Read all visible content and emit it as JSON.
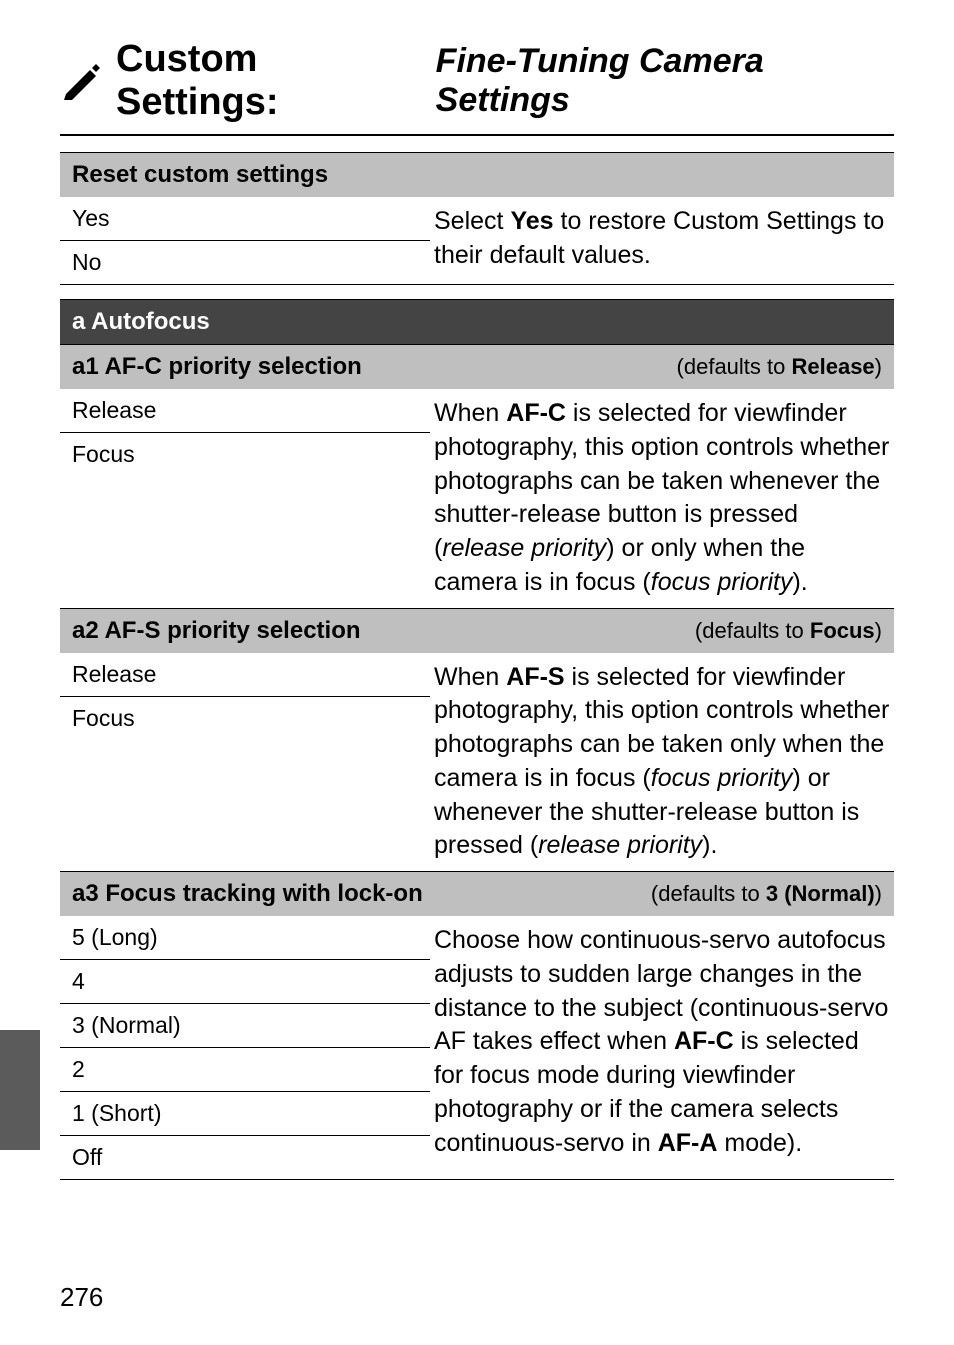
{
  "title": {
    "bold": "Custom Settings:",
    "italic": "Fine-Tuning Camera Settings"
  },
  "reset": {
    "header": "Reset custom settings",
    "options": [
      "Yes",
      "No"
    ],
    "desc": "Select <b>Yes</b> to restore Custom Settings to their default values."
  },
  "section_a": {
    "header": "a Autofocus"
  },
  "a1": {
    "header_left": "a1   AF-C priority selection",
    "header_right": "(defaults to <b>Release</b>)",
    "options": [
      "Release",
      "Focus"
    ],
    "desc": "When <b>AF-C</b> is selected for viewfinder photography, this option controls whether photographs can be taken whenever the shutter-release button is pressed (<i>release priority</i>) or only when the camera is in focus (<i>focus priority</i>)."
  },
  "a2": {
    "header_left": "a2   AF-S priority selection",
    "header_right": "(defaults to <b>Focus</b>)",
    "options": [
      "Release",
      "Focus"
    ],
    "desc": "When <b>AF-S</b> is selected for viewfinder photography, this option controls whether photographs can be taken only when the camera is in focus (<i>focus priority</i>) or whenever the shutter-release button is pressed (<i>release priority</i>)."
  },
  "a3": {
    "header_left": "a3   Focus tracking with lock-on",
    "header_right": "(defaults to <b>3 (Normal)</b>)",
    "options": [
      "5 (Long)",
      "4",
      "3 (Normal)",
      "2",
      "1 (Short)",
      "Off"
    ],
    "desc": "Choose how continuous-servo autofocus adjusts to sudden large changes in the distance to the subject (continuous-servo AF takes effect when <b>AF-C</b> is selected for focus mode during viewfinder photography or if the camera selects continuous-servo in <b>AF-A</b> mode)."
  },
  "page_number": "276"
}
